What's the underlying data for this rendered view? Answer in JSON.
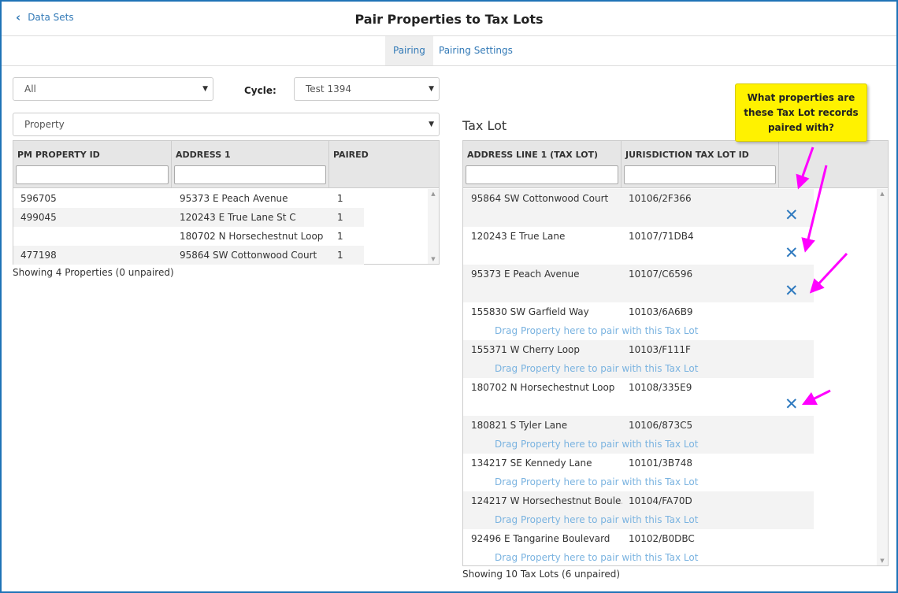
{
  "header": {
    "back_label": "Data Sets",
    "title": "Pair Properties to Tax Lots"
  },
  "tabs": [
    {
      "label": "Pairing",
      "active": true
    },
    {
      "label": "Pairing Settings",
      "active": false
    }
  ],
  "filters": {
    "scope_value": "All",
    "cycle_label": "Cycle:",
    "cycle_value": "Test 1394",
    "type_value": "Property"
  },
  "tax_lot_section_title": "Tax Lot",
  "property_table": {
    "columns": [
      "PM PROPERTY ID",
      "ADDRESS 1",
      "PAIRED"
    ],
    "rows": [
      {
        "pm_id": "596705",
        "address": "95373 E Peach Avenue",
        "paired": "1"
      },
      {
        "pm_id": "499045",
        "address": "120243 E True Lane St C",
        "paired": "1"
      },
      {
        "pm_id": "",
        "address": "180702 N Horsechestnut Loop",
        "paired": "1"
      },
      {
        "pm_id": "477198",
        "address": "95864 SW Cottonwood Court",
        "paired": "1"
      }
    ],
    "status": "Showing 4 Properties (0 unpaired)"
  },
  "taxlot_table": {
    "columns": [
      "ADDRESS LINE 1 (TAX LOT)",
      "JURISDICTION TAX LOT ID"
    ],
    "rows": [
      {
        "address": "95864 SW Cottonwood Court",
        "lot_id": "10106/2F366",
        "paired": true,
        "drag_hint": ""
      },
      {
        "address": "120243 E True Lane",
        "lot_id": "10107/71DB4",
        "paired": true,
        "drag_hint": ""
      },
      {
        "address": "95373 E Peach Avenue",
        "lot_id": "10107/C6596",
        "paired": true,
        "drag_hint": ""
      },
      {
        "address": "155830 SW Garfield Way",
        "lot_id": "10103/6A6B9",
        "paired": false,
        "drag_hint": "Drag Property here to pair with this Tax Lot"
      },
      {
        "address": "155371 W Cherry Loop",
        "lot_id": "10103/F111F",
        "paired": false,
        "drag_hint": "Drag Property here to pair with this Tax Lot"
      },
      {
        "address": "180702 N Horsechestnut Loop",
        "lot_id": "10108/335E9",
        "paired": true,
        "drag_hint": ""
      },
      {
        "address": "180821 S Tyler Lane",
        "lot_id": "10106/873C5",
        "paired": false,
        "drag_hint": "Drag Property here to pair with this Tax Lot"
      },
      {
        "address": "134217 SE Kennedy Lane",
        "lot_id": "10101/3B748",
        "paired": false,
        "drag_hint": "Drag Property here to pair with this Tax Lot"
      },
      {
        "address": "124217 W Horsechestnut Boule...",
        "lot_id": "10104/FA70D",
        "paired": false,
        "drag_hint": "Drag Property here to pair with this Tax Lot"
      },
      {
        "address": "92496 E Tangarine Boulevard",
        "lot_id": "10102/B0DBC",
        "paired": false,
        "drag_hint": "Drag Property here to pair with this Tax Lot"
      }
    ],
    "unpair_icon": "close-x-icon",
    "status": "Showing 10 Tax Lots (6 unpaired)"
  },
  "callout": {
    "text_line1": "What properties are",
    "text_line2": "these Tax Lot records",
    "text_line3": "paired with?"
  },
  "colors": {
    "link": "#337ab7",
    "frame_border": "#1f73b7",
    "callout_bg": "#fff200",
    "arrow": "#ff00ff",
    "drag_hint": "#7ab3e0",
    "unpair_x": "#2f7abf"
  }
}
